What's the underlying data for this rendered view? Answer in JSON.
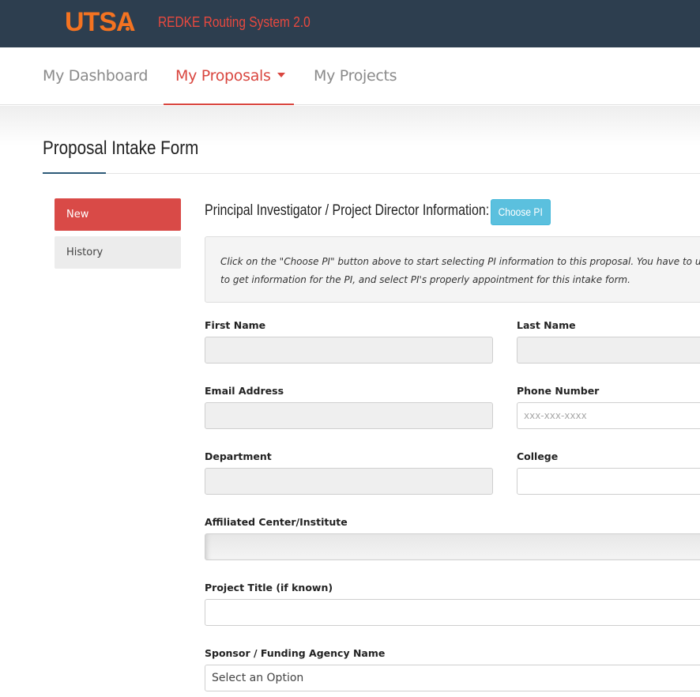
{
  "header": {
    "logo": "UTSA",
    "app_title": "REDKE Routing System 2.0"
  },
  "nav": {
    "items": [
      {
        "label": "My Dashboard",
        "active": false
      },
      {
        "label": "My Proposals",
        "active": true,
        "has_dropdown": true
      },
      {
        "label": "My Projects",
        "active": false
      }
    ]
  },
  "page": {
    "title": "Proposal Intake Form"
  },
  "sidebar": {
    "items": [
      {
        "label": "New",
        "active": true
      },
      {
        "label": "History",
        "active": false
      }
    ]
  },
  "section": {
    "heading": "Principal Investigator / Project Director Information:",
    "choose_pi_label": "Choose PI",
    "info_line1": "Click on the \"Choose PI\" button above to start selecting PI information to this proposal. You have to use the",
    "info_line2": "to get information for the PI, and select PI's properly appointment for this intake form."
  },
  "form": {
    "first_name": {
      "label": "First Name",
      "value": ""
    },
    "last_name": {
      "label": "Last Name",
      "value": ""
    },
    "email": {
      "label": "Email Address",
      "value": ""
    },
    "phone": {
      "label": "Phone Number",
      "value": "",
      "placeholder": "xxx-xxx-xxxx"
    },
    "department": {
      "label": "Department",
      "value": ""
    },
    "college": {
      "label": "College",
      "value": ""
    },
    "affiliated_center": {
      "label": "Affiliated Center/Institute",
      "value": ""
    },
    "project_title": {
      "label": "Project Title (if known)",
      "value": ""
    },
    "sponsor": {
      "label": "Sponsor / Funding Agency Name",
      "selected": "Select an Option"
    }
  },
  "colors": {
    "topbar": "#2d3e4f",
    "brand_orange": "#f47321",
    "accent_red": "#d9463f",
    "button_info": "#5bc0de"
  }
}
